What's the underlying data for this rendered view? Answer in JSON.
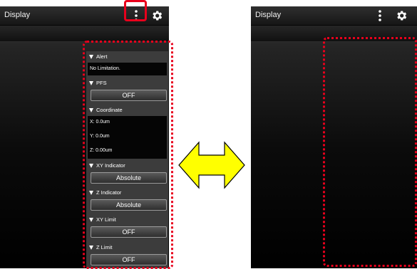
{
  "left_screen": {
    "title": "Display",
    "panel": {
      "alert": {
        "header": "Alert",
        "text": "No Limitation."
      },
      "pfs": {
        "header": "PFS",
        "button": "OFF"
      },
      "coordinate": {
        "header": "Coordinate",
        "x": "X: 0.0um",
        "y": "Y: 0.0um",
        "z": "Z: 0.00um"
      },
      "xy_indicator": {
        "header": "XY Indicator",
        "button": "Absolute"
      },
      "z_indicator": {
        "header": "Z Indicator",
        "button": "Absolute"
      },
      "xy_limit": {
        "header": "XY Limit",
        "button": "OFF"
      },
      "z_limit": {
        "header": "Z Limit",
        "button": "OFF"
      }
    }
  },
  "right_screen": {
    "title": "Display"
  },
  "icons": {
    "menu": "more-vertical-icon",
    "settings": "gear-icon",
    "toggle": "double-arrow-icon"
  },
  "colors": {
    "highlight": "#e8001c",
    "arrow_fill": "#ffff00",
    "panel_bg": "#3c3c3c"
  }
}
